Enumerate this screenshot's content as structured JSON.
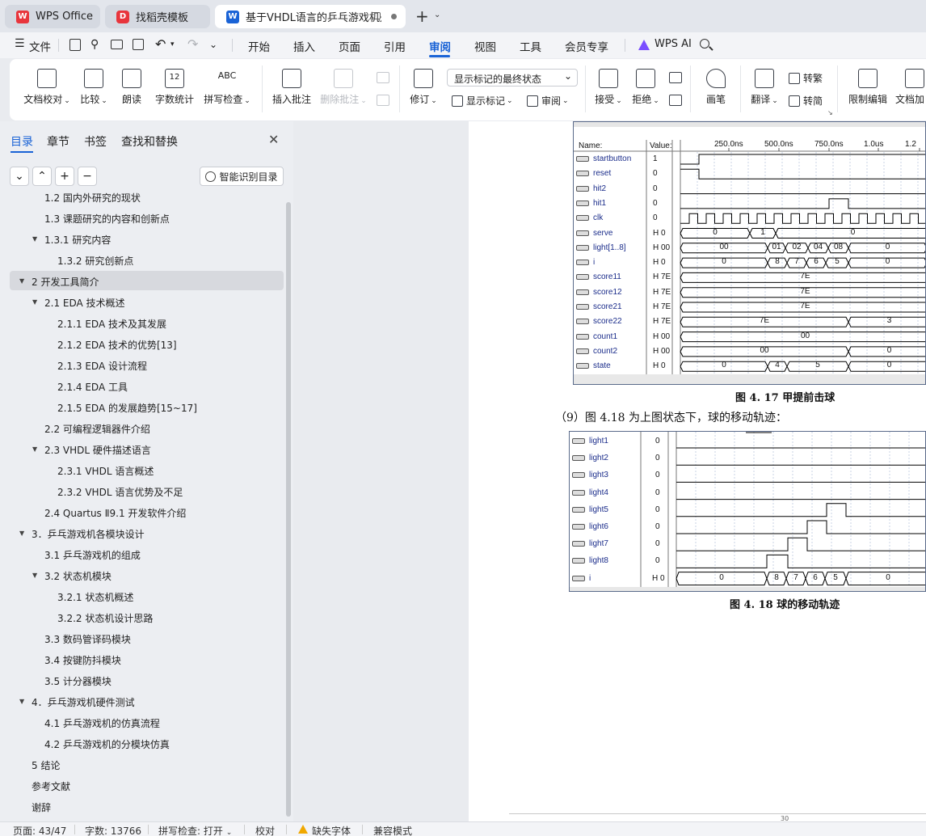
{
  "tabs": [
    {
      "label": "WPS Office",
      "logo": "W"
    },
    {
      "label": "找稻壳模板",
      "logo": "D"
    },
    {
      "label": "基于VHDL语言的乒乓游戏机是",
      "logo": "W"
    }
  ],
  "menu": {
    "file": "文件",
    "items": [
      "开始",
      "插入",
      "页面",
      "引用",
      "审阅",
      "视图",
      "工具",
      "会员专享"
    ],
    "active": "审阅",
    "ai": "WPS AI"
  },
  "ribbon": {
    "doc_check": "文档校对",
    "compare": "比较",
    "read_aloud": "朗读",
    "word_count": "字数统计",
    "spell_check": "拼写检查",
    "insert_comment": "插入批注",
    "delete_comment": "删除批注",
    "revise": "修订",
    "markup_select": "显示标记的最终状态",
    "show_markup": "显示标记",
    "review": "审阅",
    "accept": "接受",
    "reject": "拒绝",
    "pen": "画笔",
    "translate": "翻译",
    "to_traditional": "转繁",
    "to_simplified": "转简",
    "restrict_edit": "限制编辑",
    "doc_encrypt": "文档加"
  },
  "leftpane": {
    "tabs": [
      "目录",
      "章节",
      "书签",
      "查找和替换"
    ],
    "smart_toc": "智能识别目录",
    "toc": [
      {
        "text": "1.2 国内外研究的现状",
        "level": 2
      },
      {
        "text": "1.3 课题研究的内容和创新点",
        "level": 2
      },
      {
        "text": "1.3.1  研究内容",
        "level": 2,
        "arrow": true
      },
      {
        "text": "1.3.2  研究创新点",
        "level": 3
      },
      {
        "text": "2  开发工具简介",
        "level": 1,
        "arrow": true,
        "selected": true
      },
      {
        "text": "2.1 EDA 技术概述",
        "level": 2,
        "arrow": true
      },
      {
        "text": "2.1.1 EDA 技术及其发展",
        "level": 3
      },
      {
        "text": "2.1.2 EDA 技术的优势[13]",
        "level": 3
      },
      {
        "text": "2.1.3 EDA 设计流程",
        "level": 3
      },
      {
        "text": "2.1.4 EDA 工具",
        "level": 3
      },
      {
        "text": "2.1.5 EDA 的发展趋势[15~17]",
        "level": 3
      },
      {
        "text": "2.2 可编程逻辑器件介绍",
        "level": 2
      },
      {
        "text": "2.3 VHDL 硬件描述语言",
        "level": 2,
        "arrow": true
      },
      {
        "text": "2.3.1 VHDL 语言概述",
        "level": 3
      },
      {
        "text": "2.3.2 VHDL 语言优势及不足",
        "level": 3
      },
      {
        "text": "2.4 Quartus Ⅱ9.1 开发软件介绍",
        "level": 2
      },
      {
        "text": "3．乒乓游戏机各模块设计",
        "level": 1,
        "arrow": true
      },
      {
        "text": "3.1 乒乓游戏机的组成",
        "level": 2
      },
      {
        "text": "3.2 状态机模块",
        "level": 2,
        "arrow": true
      },
      {
        "text": "3.2.1  状态机概述",
        "level": 3
      },
      {
        "text": "3.2.2  状态机设计思路",
        "level": 3
      },
      {
        "text": "3.3 数码管译码模块",
        "level": 2
      },
      {
        "text": "3.4 按键防抖模块",
        "level": 2
      },
      {
        "text": "3.5 计分器模块",
        "level": 2
      },
      {
        "text": "4．乒乓游戏机硬件测试",
        "level": 1,
        "arrow": true
      },
      {
        "text": "4.1 乒乓游戏机的仿真流程",
        "level": 2
      },
      {
        "text": "4.2 乒乓游戏机的分模块仿真",
        "level": 2
      },
      {
        "text": "5  结论",
        "level": 1
      },
      {
        "text": "参考文献",
        "level": 1
      },
      {
        "text": "谢辞",
        "level": 1
      }
    ]
  },
  "document": {
    "wave1": {
      "header_name": "Name:",
      "header_value": "Value:",
      "time_ticks": [
        "250.0ns",
        "500.0ns",
        "750.0ns",
        "1.0us",
        "1.2"
      ],
      "signals": [
        {
          "name": "startbutton",
          "value": "1"
        },
        {
          "name": "reset",
          "value": "0"
        },
        {
          "name": "hit2",
          "value": "0"
        },
        {
          "name": "hit1",
          "value": "0"
        },
        {
          "name": "clk",
          "value": "0"
        },
        {
          "name": "serve",
          "value": "H 0"
        },
        {
          "name": "light[1..8]",
          "value": "H 00"
        },
        {
          "name": "i",
          "value": "H 0"
        },
        {
          "name": "score11",
          "value": "H 7E"
        },
        {
          "name": "score12",
          "value": "H 7E"
        },
        {
          "name": "score21",
          "value": "H 7E"
        },
        {
          "name": "score22",
          "value": "H 7E"
        },
        {
          "name": "count1",
          "value": "H 00"
        },
        {
          "name": "count2",
          "value": "H 00"
        },
        {
          "name": "state",
          "value": "H 0"
        }
      ],
      "bus_labels": {
        "serve": [
          "0",
          "1",
          "0"
        ],
        "light": [
          "00",
          "01",
          "02",
          "04",
          "08",
          "0"
        ],
        "i": [
          "0",
          "8",
          "7",
          "6",
          "5",
          "0"
        ],
        "score11": [
          "7E"
        ],
        "score12": [
          "7E"
        ],
        "score21": [
          "7E"
        ],
        "score22": [
          "7E",
          "3"
        ],
        "count1": [
          "00"
        ],
        "count2": [
          "00",
          "0"
        ],
        "state": [
          "0",
          "4",
          "5",
          "0"
        ]
      }
    },
    "caption1": "图 4. 17 甲提前击球",
    "paragraph": "（9）图 4.18 为上图状态下，球的移动轨迹：",
    "wave2": {
      "signals": [
        {
          "name": "light1",
          "value": "0"
        },
        {
          "name": "light2",
          "value": "0"
        },
        {
          "name": "light3",
          "value": "0"
        },
        {
          "name": "light4",
          "value": "0"
        },
        {
          "name": "light5",
          "value": "0"
        },
        {
          "name": "light6",
          "value": "0"
        },
        {
          "name": "light7",
          "value": "0"
        },
        {
          "name": "light8",
          "value": "0"
        },
        {
          "name": "i",
          "value": "H 0"
        }
      ],
      "i_labels": [
        "0",
        "8",
        "7",
        "6",
        "5",
        "0"
      ]
    },
    "caption2": "图 4. 18 球的移动轨迹",
    "page_number": "30"
  },
  "status": {
    "page": "页面: 43/47",
    "words": "字数: 13766",
    "spell": "拼写检查: 打开",
    "proof": "校对",
    "missing_font": "缺失字体",
    "compat": "兼容模式"
  },
  "colors": {
    "accent": "#1a63d6",
    "wps_red": "#e8353c"
  }
}
